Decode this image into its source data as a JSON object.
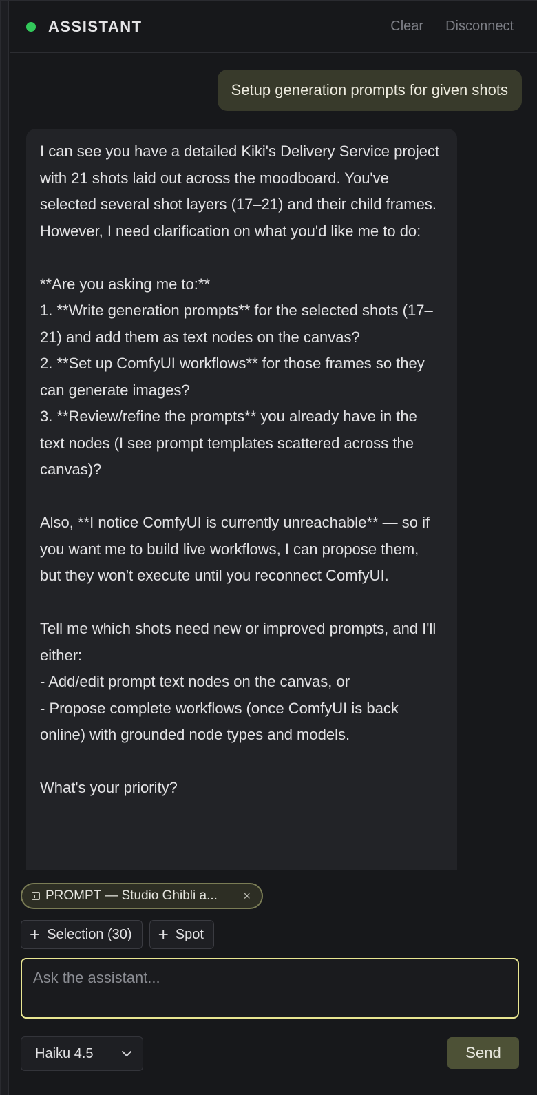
{
  "header": {
    "title": "ASSISTANT",
    "status_color": "#32c85a",
    "clear_label": "Clear",
    "disconnect_label": "Disconnect"
  },
  "messages": {
    "user": "Setup generation prompts for given shots",
    "assistant": "I can see you have a detailed Kiki's Delivery Service project with 21 shots laid out across the moodboard. You've selected several shot layers (17–21) and their child frames. However, I need clarification on what you'd like me to do:\n\n**Are you asking me to:**\n1. **Write generation prompts** for the selected shots (17–21) and add them as text nodes on the canvas?\n2. **Set up ComfyUI workflows** for those frames so they can generate images?\n3. **Review/refine the prompts** you already have in the text nodes (I see prompt templates scattered across the canvas)?\n\nAlso, **I notice ComfyUI is currently unreachable** — so if you want me to build live workflows, I can propose them, but they won't execute until you reconnect ComfyUI.\n\nTell me which shots need new or improved prompts, and I'll either:\n- Add/edit prompt text nodes on the canvas, or\n- Propose complete workflows (once ComfyUI is back online) with grounded node types and models.\n\nWhat's your priority?"
  },
  "composer": {
    "chip_label": "PROMPT — Studio Ghibli a...",
    "chip_close": "×",
    "selection_label": "Selection (30)",
    "spot_label": "Spot",
    "input_placeholder": "Ask the assistant...",
    "input_value": "",
    "model_selected": "Haiku 4.5",
    "send_label": "Send"
  },
  "icons": {
    "status": "status-dot-icon",
    "chip": "frame-icon",
    "close": "close-icon",
    "plus": "plus-icon",
    "chevron": "chevron-down-icon"
  }
}
